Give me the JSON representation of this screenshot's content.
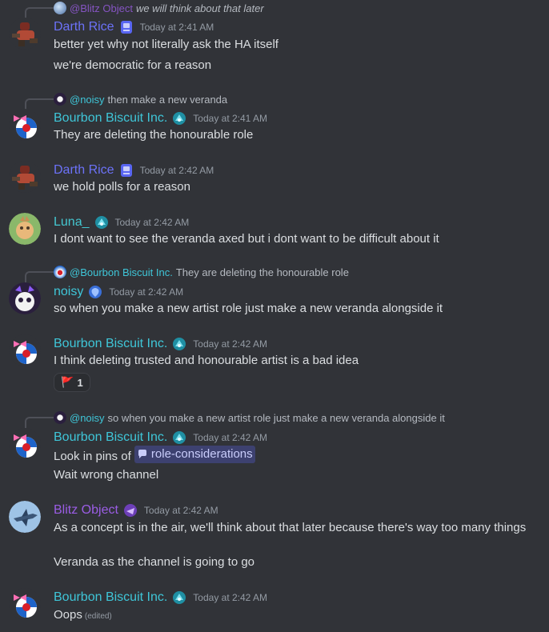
{
  "colors": {
    "background": "#313338",
    "text": "#dbdee1",
    "timestamp": "#949ba4",
    "darth_rice": "#6c72f8",
    "bourbon": "#3fc6d8",
    "luna": "#44c7d0",
    "noisy": "#3fc6d8",
    "blitz": "#9b5de5",
    "mention_bg": "#5865f2"
  },
  "messages": [
    {
      "reply": {
        "name": "@Blitz Object",
        "text": "we will think about that later"
      },
      "author": "Darth Rice",
      "timestamp": "Today at 2:41 AM",
      "lines": [
        "better yet why not literally ask the HA itself",
        "we're democratic for a reason"
      ]
    },
    {
      "reply": {
        "name": "@noisy",
        "text": "then make a new veranda"
      },
      "author": "Bourbon Biscuit Inc.",
      "timestamp": "Today at 2:41 AM",
      "lines": [
        "They are deleting the honourable role"
      ]
    },
    {
      "author": "Darth Rice",
      "timestamp": "Today at 2:42 AM",
      "lines": [
        "we hold polls for a reason"
      ]
    },
    {
      "author": "Luna_",
      "timestamp": "Today at 2:42 AM",
      "lines": [
        "I dont want to see the veranda axed but i dont want to be difficult about it"
      ]
    },
    {
      "reply": {
        "name": "@Bourbon Biscuit Inc.",
        "text": "They are deleting the honourable role"
      },
      "author": "noisy",
      "timestamp": "Today at 2:42 AM",
      "lines": [
        "so when you make a new artist role just make a new veranda alongside it"
      ]
    },
    {
      "author": "Bourbon Biscuit Inc.",
      "timestamp": "Today at 2:42 AM",
      "lines": [
        "I think deleting trusted and honourable artist is a bad idea"
      ],
      "reaction": {
        "emoji": "🚩",
        "count": "1"
      }
    },
    {
      "reply": {
        "name": "@noisy",
        "text": "so when you make a new artist role just make a new veranda alongside it"
      },
      "author": "Bourbon Biscuit Inc.",
      "timestamp": "Today at 2:42 AM",
      "line1_prefix": "Look in pins of",
      "channel_mention": "role-considerations",
      "lines": [
        "Wait wrong channel"
      ]
    },
    {
      "author": "Blitz Object",
      "timestamp": "Today at 2:42 AM",
      "lines": [
        "As a concept is in the air, we'll think about that later because there's way too many things",
        "Veranda as the channel is going to go"
      ]
    },
    {
      "author": "Bourbon Biscuit Inc.",
      "timestamp": "Today at 2:42 AM",
      "lines": [
        "Oops"
      ],
      "edited": "(edited)"
    }
  ]
}
